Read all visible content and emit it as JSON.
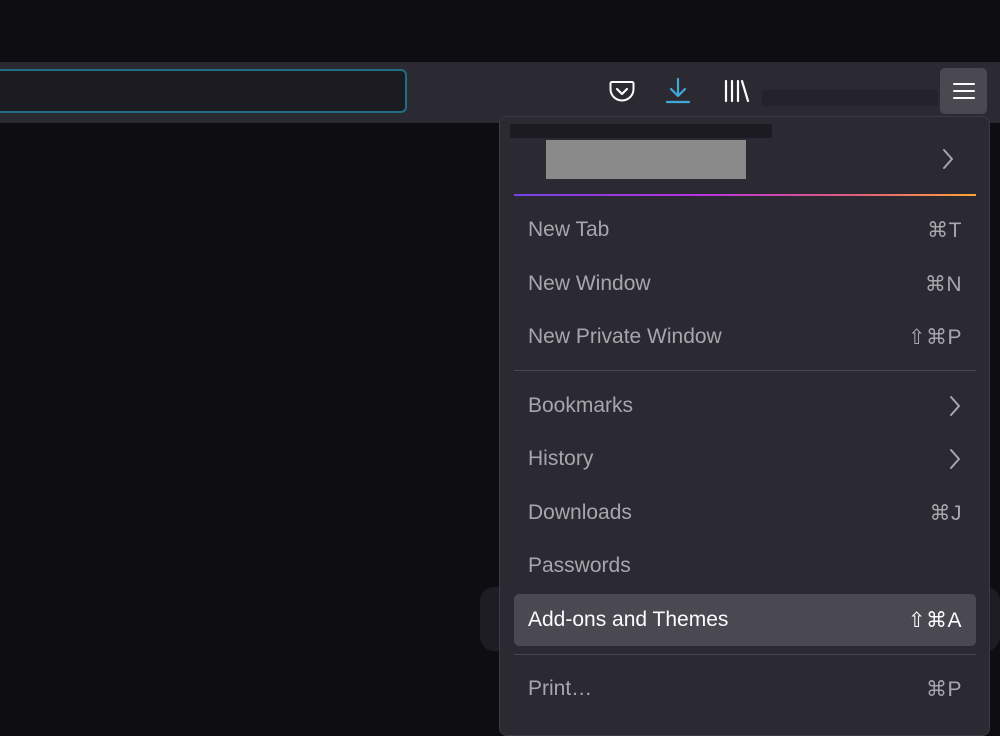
{
  "toolbar": {
    "icons": [
      "pocket-icon",
      "download-icon",
      "library-icon",
      "hamburger-menu-icon"
    ],
    "accent_color": "#1f6f84"
  },
  "menu": {
    "items": [
      {
        "label": "New Tab",
        "shortcut": "⌘T"
      },
      {
        "label": "New Window",
        "shortcut": "⌘N"
      },
      {
        "label": "New Private Window",
        "shortcut": "⇧⌘P"
      },
      {
        "label": "Bookmarks",
        "shortcut": ""
      },
      {
        "label": "History",
        "shortcut": ""
      },
      {
        "label": "Downloads",
        "shortcut": "⌘J"
      },
      {
        "label": "Passwords",
        "shortcut": ""
      },
      {
        "label": "Add-ons and Themes",
        "shortcut": "⇧⌘A"
      },
      {
        "label": "Print…",
        "shortcut": "⌘P"
      }
    ],
    "highlight_color": "#4a4951"
  }
}
